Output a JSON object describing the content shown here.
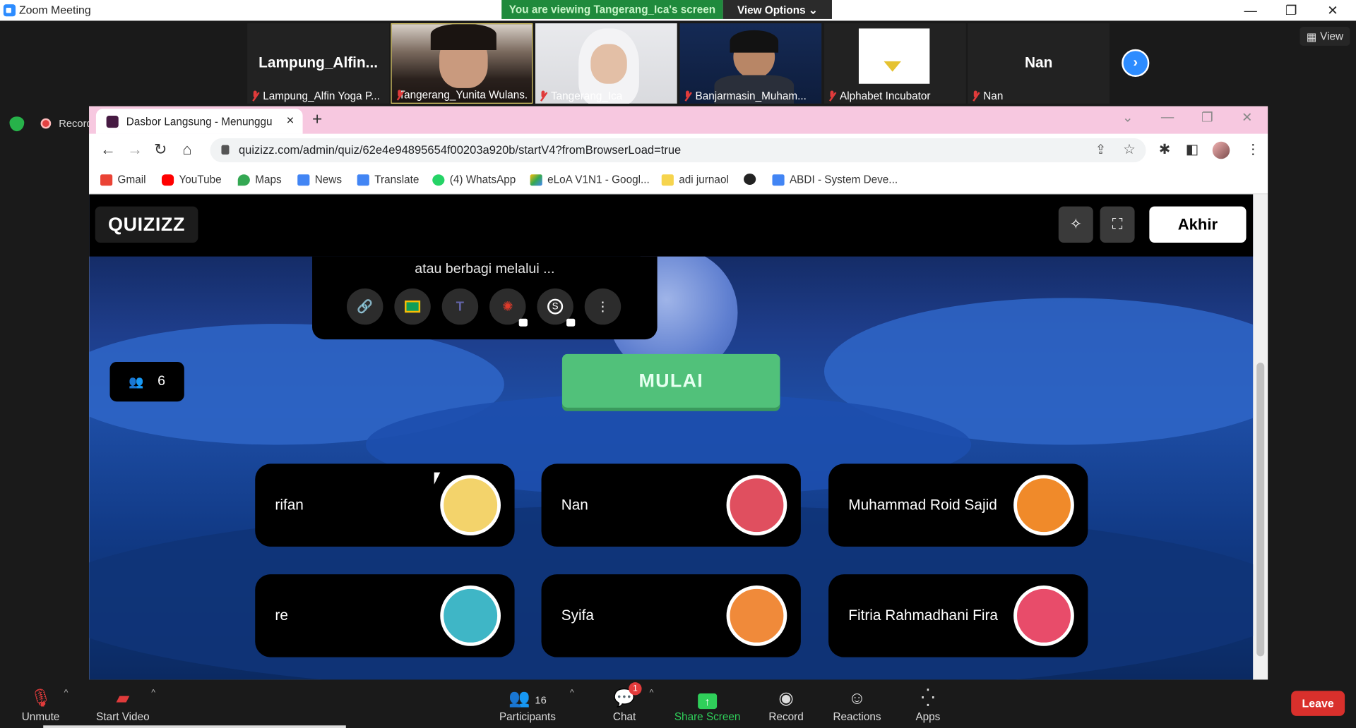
{
  "window": {
    "title": "Zoom Meeting",
    "minimize": "—",
    "restore": "❐",
    "close": "✕"
  },
  "banner": {
    "viewing": "You are viewing Tangerang_Ica's screen",
    "view_options": "View Options ⌄"
  },
  "participants_strip": {
    "tiles": [
      {
        "big_name": "Lampung_Alfin...",
        "label": "Lampung_Alfin Yoga P..."
      },
      {
        "label": "Tangerang_Yunita Wulans..."
      },
      {
        "label": "Tangerang_Ica"
      },
      {
        "label": "Banjarmasin_Muham..."
      },
      {
        "label": "Alphabet Incubator"
      },
      {
        "big_name": "Nan",
        "label": "Nan"
      }
    ],
    "view_label": "View",
    "recording_label": "Record"
  },
  "browser": {
    "tab_title": "Dasbor Langsung - Menunggu",
    "url": "quizizz.com/admin/quiz/62e4e94895654f00203a920b/startV4?fromBrowserLoad=true",
    "bookmarks": [
      "Gmail",
      "YouTube",
      "Maps",
      "News",
      "Translate",
      "(4) WhatsApp",
      "eLoA V1N1 - Googl...",
      "adi jurnaol",
      "",
      "ABDI - System Deve..."
    ]
  },
  "quizizz": {
    "logo": "QUIZIZZ",
    "end_button": "Akhir",
    "share_text": "atau berbagi melalui ...",
    "player_count": "6",
    "start_button": "MULAI",
    "players": [
      "rifan",
      "Nan",
      "Muhammad Roid Sajid",
      "re",
      "Syifa",
      "Fitria Rahmadhani Fira"
    ]
  },
  "zoom_bar": {
    "unmute": "Unmute",
    "start_video": "Start Video",
    "participants": "Participants",
    "participants_count": "16",
    "chat": "Chat",
    "chat_badge": "1",
    "share_screen": "Share Screen",
    "record": "Record",
    "reactions": "Reactions",
    "apps": "Apps",
    "leave": "Leave"
  },
  "colors": {
    "share_green": "#2fcf5a",
    "mulai_green": "#51c17a",
    "leave_red": "#d9302c",
    "zoom_blue": "#2d8cff"
  }
}
